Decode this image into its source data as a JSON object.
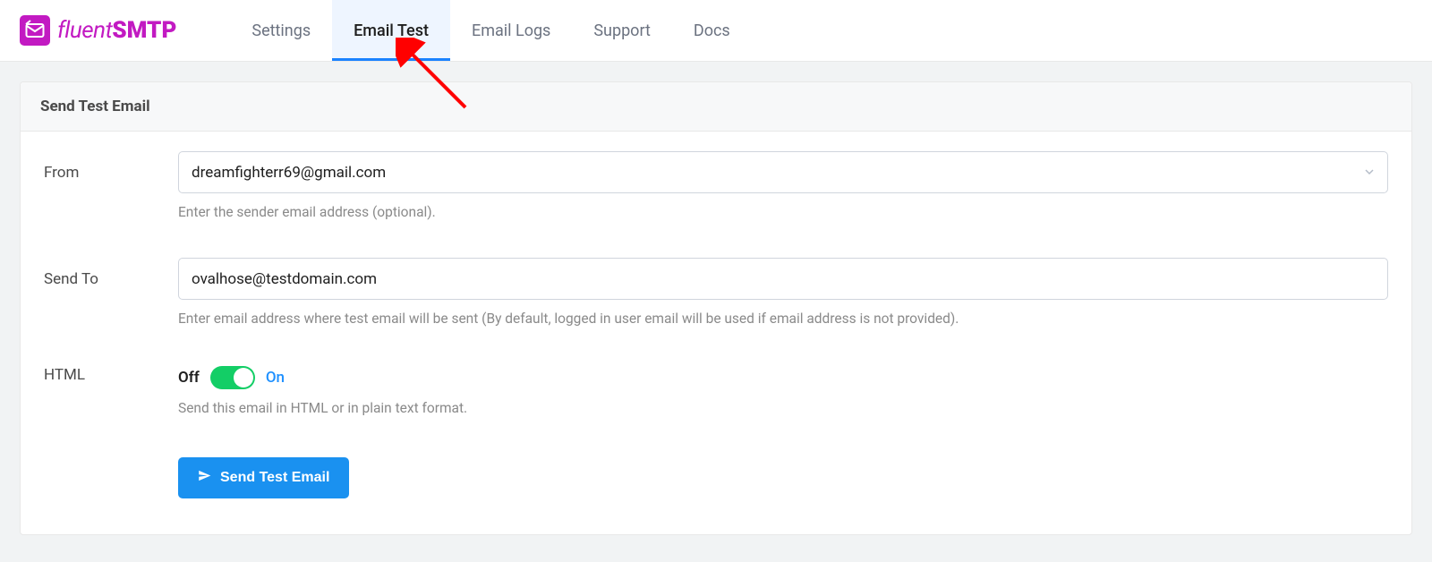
{
  "logo": {
    "text_light": "fluent",
    "text_bold": "SMTP"
  },
  "tabs": {
    "settings": "Settings",
    "email_test": "Email Test",
    "email_logs": "Email Logs",
    "support": "Support",
    "docs": "Docs"
  },
  "panel": {
    "title": "Send Test Email"
  },
  "form": {
    "from": {
      "label": "From",
      "value": "dreamfighterr69@gmail.com",
      "hint": "Enter the sender email address (optional)."
    },
    "send_to": {
      "label": "Send To",
      "value": "ovalhose@testdomain.com",
      "hint": "Enter email address where test email will be sent (By default, logged in user email will be used if email address is not provided)."
    },
    "html_toggle": {
      "label": "HTML",
      "off_label": "Off",
      "on_label": "On",
      "state": "on",
      "hint": "Send this email in HTML or in plain text format."
    },
    "submit": {
      "label": "Send Test Email"
    }
  }
}
